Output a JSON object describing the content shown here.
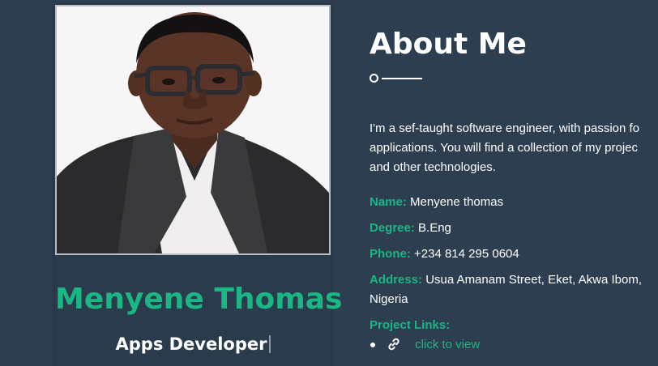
{
  "profile": {
    "name": "Menyene Thomas",
    "role": "Apps Developer",
    "photo_alt": "profile photo"
  },
  "about": {
    "title": "About Me",
    "bio_lines": [
      "I'm a sef-taught software engineer, with passion fo",
      "applications. You will find a collection of my projec",
      "and other technologies."
    ],
    "details": {
      "name_label": "Name:",
      "name_value": "Menyene thomas",
      "degree_label": "Degree:",
      "degree_value": "B.Eng",
      "phone_label": "Phone:",
      "phone_value": "+234 814 295 0604",
      "address_label": "Address:",
      "address_value_line1": "Usua Amanam Street, Eket, Akwa Ibom,",
      "address_value_line2": "Nigeria",
      "links_label": "Project Links:"
    },
    "links": [
      {
        "icon": "link-icon",
        "label": "click to view"
      }
    ]
  },
  "colors": {
    "background": "#2d3e50",
    "accent": "#1ab683",
    "text": "#ffffff"
  }
}
